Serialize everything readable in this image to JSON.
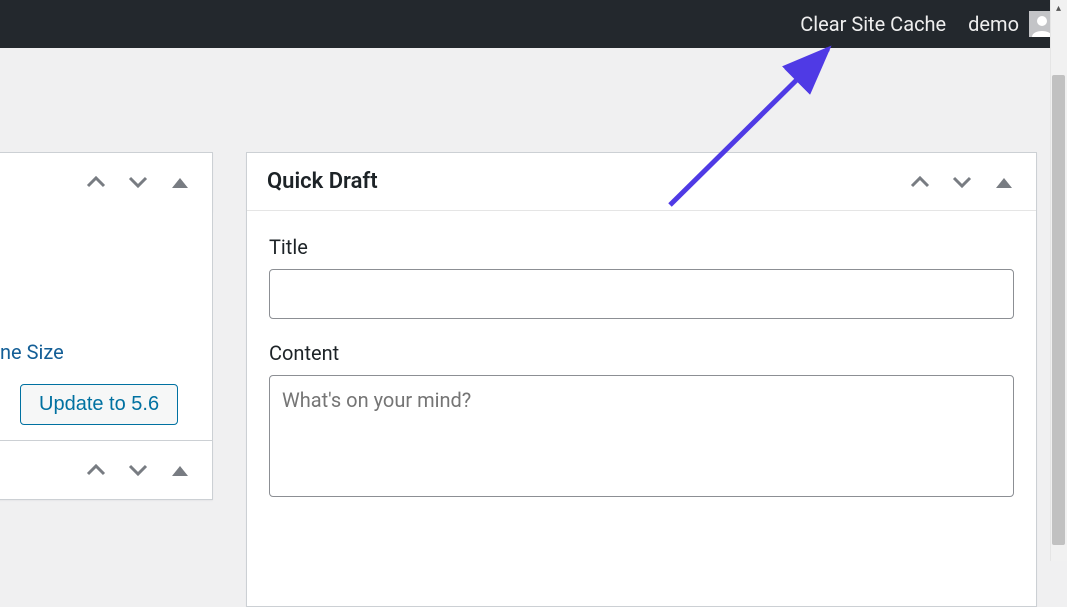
{
  "adminbar": {
    "clear_cache_label": "Clear Site Cache",
    "username": "demo"
  },
  "left_body": {
    "link_text_fragment": "ne Size",
    "update_button_label": "Update to 5.6"
  },
  "quickdraft": {
    "title": "Quick Draft",
    "title_label": "Title",
    "content_label": "Content",
    "content_placeholder": "What's on your mind?"
  },
  "colors": {
    "accent_link": "#135e96",
    "accent_button": "#0071a1",
    "arrow": "#4f3ae5"
  }
}
